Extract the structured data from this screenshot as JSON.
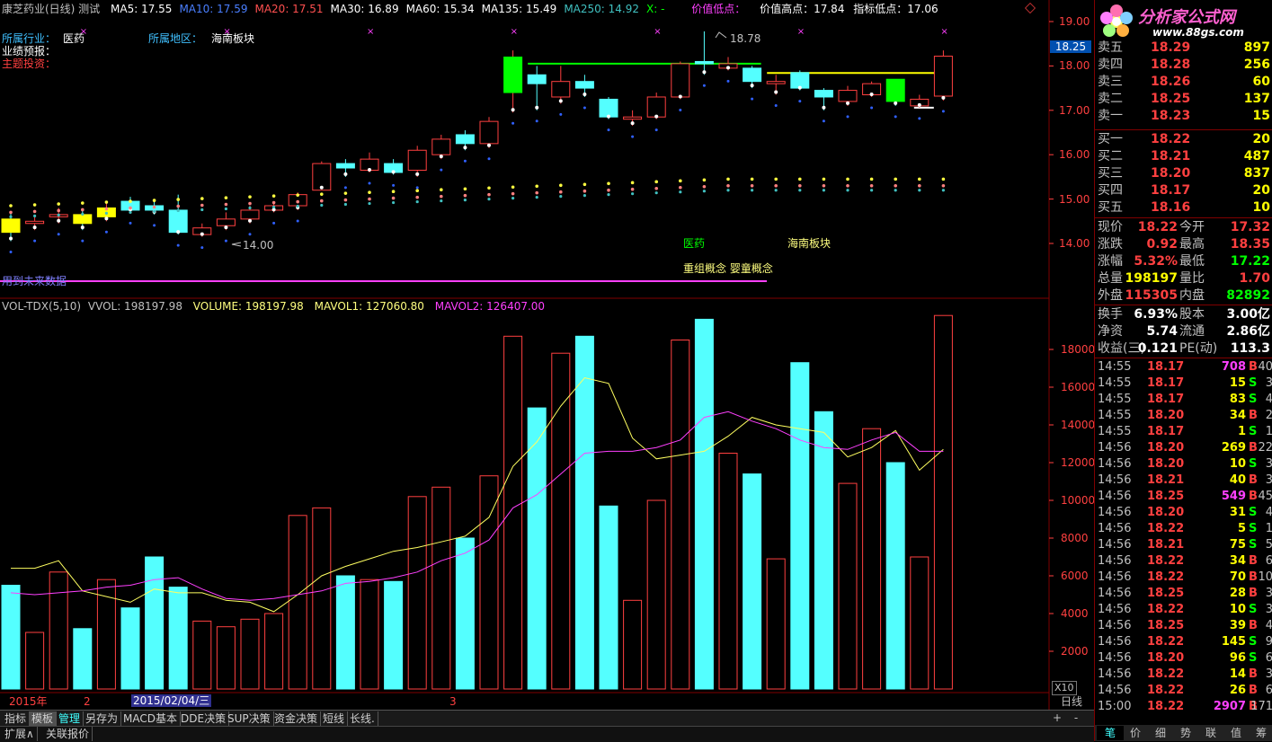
{
  "header": {
    "stock_name": "康芝药业(日线) 测试",
    "ma_items": [
      {
        "label": "MA5: 17.55",
        "color": "#ffffff"
      },
      {
        "label": "MA10: 17.59",
        "color": "#4a7fff"
      },
      {
        "label": "MA20: 17.51",
        "color": "#ff5050"
      },
      {
        "label": "MA30: 16.89",
        "color": "#ffffff"
      },
      {
        "label": "MA60: 15.34",
        "color": "#ffffff"
      },
      {
        "label": "MA135: 15.49",
        "color": "#ffffff"
      },
      {
        "label": "MA250: 14.92",
        "color": "#40c0c0"
      },
      {
        "label": "X: -",
        "color": "#00ff00"
      }
    ],
    "value_low_label": "价值低点：",
    "value_high_label": "价值高点：17.84",
    "indicator_low_label": "指标低点：17.06"
  },
  "info": {
    "industry_label": "所属行业：",
    "industry_value": "医药",
    "region_label": "所属地区：",
    "region_value": "海南板块",
    "forecast_label": "业绩预报：",
    "theme_label": "主题投资："
  },
  "annotations": {
    "high_mark": "18.78",
    "low_mark": "14.00",
    "industry_tag": "医药",
    "region_tag": "海南板块",
    "concept_tag": "重组概念 婴童概念",
    "future_data": "用到未来数据"
  },
  "price_axis": [
    "19.00",
    "18.00",
    "17.00",
    "16.00",
    "15.00",
    "14.00"
  ],
  "current_price_tag": "18.25",
  "volume_header": {
    "name": "VOL-TDX(5,10)",
    "vvol": "VVOL: 198197.98",
    "volume": "VOLUME: 198197.98",
    "mavol1": "MAVOL1: 127060.80",
    "mavol2": "MAVOL2: 126407.00"
  },
  "volume_axis": [
    "18000",
    "16000",
    "14000",
    "12000",
    "10000",
    "8000",
    "6000",
    "4000",
    "2000"
  ],
  "volume_unit": "X10",
  "date_axis": {
    "year": "2015年",
    "m2": "2",
    "m3": "3",
    "cursor_date": "2015/02/04/三",
    "period": "日线"
  },
  "chart_data": {
    "type": "candlestick",
    "candles": [
      {
        "o": 14.55,
        "c": 14.25,
        "h": 14.7,
        "l": 14.05,
        "v": 5500
      },
      {
        "o": 14.45,
        "c": 14.5,
        "h": 14.6,
        "l": 14.3,
        "v": 3000
      },
      {
        "o": 14.6,
        "c": 14.65,
        "h": 14.8,
        "l": 14.45,
        "v": 6200
      },
      {
        "o": 14.65,
        "c": 14.45,
        "h": 14.75,
        "l": 14.3,
        "v": 3200
      },
      {
        "o": 14.6,
        "c": 14.8,
        "h": 14.95,
        "l": 14.5,
        "v": 5800
      },
      {
        "o": 14.95,
        "c": 14.75,
        "h": 15.05,
        "l": 14.7,
        "v": 4300
      },
      {
        "o": 14.85,
        "c": 14.75,
        "h": 14.95,
        "l": 14.65,
        "v": 7000
      },
      {
        "o": 14.75,
        "c": 14.25,
        "h": 15.1,
        "l": 14.2,
        "v": 5400
      },
      {
        "o": 14.2,
        "c": 14.35,
        "h": 14.45,
        "l": 14.15,
        "v": 3600
      },
      {
        "o": 14.4,
        "c": 14.55,
        "h": 14.7,
        "l": 14.3,
        "v": 3300
      },
      {
        "o": 14.55,
        "c": 14.75,
        "h": 14.85,
        "l": 14.45,
        "v": 3700
      },
      {
        "o": 14.75,
        "c": 14.85,
        "h": 14.9,
        "l": 14.7,
        "v": 4000
      },
      {
        "o": 14.85,
        "c": 15.1,
        "h": 15.15,
        "l": 14.75,
        "v": 9200
      },
      {
        "o": 15.2,
        "c": 15.8,
        "h": 15.85,
        "l": 15.2,
        "v": 9600
      },
      {
        "o": 15.8,
        "c": 15.7,
        "h": 15.9,
        "l": 15.5,
        "v": 6000
      },
      {
        "o": 15.65,
        "c": 15.9,
        "h": 16.05,
        "l": 15.6,
        "v": 5800
      },
      {
        "o": 15.8,
        "c": 15.6,
        "h": 15.9,
        "l": 15.55,
        "v": 5700
      },
      {
        "o": 15.65,
        "c": 16.1,
        "h": 16.2,
        "l": 15.5,
        "v": 10200
      },
      {
        "o": 16.0,
        "c": 16.35,
        "h": 16.45,
        "l": 15.9,
        "v": 10700
      },
      {
        "o": 16.45,
        "c": 16.25,
        "h": 16.55,
        "l": 16.1,
        "v": 8000
      },
      {
        "o": 16.25,
        "c": 16.75,
        "h": 16.85,
        "l": 16.15,
        "v": 11300
      },
      {
        "o": 17.4,
        "c": 18.2,
        "h": 18.35,
        "l": 16.95,
        "v": 18700
      },
      {
        "o": 17.8,
        "c": 17.6,
        "h": 18.0,
        "l": 17.0,
        "v": 14900
      },
      {
        "o": 17.3,
        "c": 17.65,
        "h": 18.0,
        "l": 17.15,
        "v": 17800
      },
      {
        "o": 17.65,
        "c": 17.5,
        "h": 17.8,
        "l": 17.3,
        "v": 18700
      },
      {
        "o": 17.25,
        "c": 16.85,
        "h": 17.3,
        "l": 16.8,
        "v": 9700
      },
      {
        "o": 16.8,
        "c": 16.85,
        "h": 17.0,
        "l": 16.65,
        "v": 4700
      },
      {
        "o": 16.85,
        "c": 17.3,
        "h": 17.4,
        "l": 16.8,
        "v": 10000
      },
      {
        "o": 17.3,
        "c": 18.05,
        "h": 18.1,
        "l": 17.25,
        "v": 18500
      },
      {
        "o": 18.1,
        "c": 18.05,
        "h": 18.78,
        "l": 17.8,
        "v": 19600
      },
      {
        "o": 17.95,
        "c": 18.05,
        "h": 18.2,
        "l": 17.9,
        "v": 12500
      },
      {
        "o": 17.95,
        "c": 17.65,
        "h": 18.0,
        "l": 17.5,
        "v": 11400
      },
      {
        "o": 17.6,
        "c": 17.65,
        "h": 17.8,
        "l": 17.35,
        "v": 6900
      },
      {
        "o": 17.85,
        "c": 17.5,
        "h": 17.9,
        "l": 17.45,
        "v": 17300
      },
      {
        "o": 17.45,
        "c": 17.3,
        "h": 17.5,
        "l": 17.0,
        "v": 14700
      },
      {
        "o": 17.2,
        "c": 17.45,
        "h": 17.55,
        "l": 17.1,
        "v": 10900
      },
      {
        "o": 17.35,
        "c": 17.6,
        "h": 17.65,
        "l": 17.3,
        "v": 13800
      },
      {
        "o": 17.7,
        "c": 17.2,
        "h": 17.7,
        "l": 17.1,
        "v": 12000
      },
      {
        "o": 17.1,
        "c": 17.25,
        "h": 17.35,
        "l": 17.06,
        "v": 7000
      },
      {
        "o": 17.32,
        "c": 18.22,
        "h": 18.35,
        "l": 17.22,
        "v": 19800
      }
    ],
    "mavol1": [
      6400,
      6400,
      6800,
      5200,
      4900,
      4600,
      5300,
      5100,
      5100,
      4700,
      4600,
      4100,
      5000,
      6000,
      6500,
      6900,
      7300,
      7500,
      7800,
      8100,
      9100,
      11800,
      13100,
      15000,
      16500,
      16200,
      13300,
      12200,
      12400,
      12600,
      13400,
      14400,
      14000,
      13800,
      13600,
      12300,
      12800,
      13700,
      11600,
      12700
    ],
    "mavol2": [
      5100,
      5000,
      5100,
      5200,
      5400,
      5500,
      5800,
      5900,
      5300,
      4800,
      4700,
      4800,
      5000,
      5200,
      5600,
      5700,
      5900,
      6200,
      6800,
      7200,
      7900,
      9600,
      10300,
      11400,
      12500,
      12600,
      12600,
      12800,
      13200,
      14400,
      14700,
      14200,
      13800,
      13200,
      12800,
      12700,
      13200,
      13600,
      12600,
      12600
    ],
    "value_high": 17.84,
    "indicator_low": 17.06,
    "green_level": 18.05
  },
  "quote": {
    "sell": [
      {
        "label": "卖五",
        "price": "18.29",
        "vol": "897"
      },
      {
        "label": "卖四",
        "price": "18.28",
        "vol": "256"
      },
      {
        "label": "卖三",
        "price": "18.26",
        "vol": "60"
      },
      {
        "label": "卖二",
        "price": "18.25",
        "vol": "137"
      },
      {
        "label": "卖一",
        "price": "18.23",
        "vol": "15"
      }
    ],
    "buy": [
      {
        "label": "买一",
        "price": "18.22",
        "vol": "20"
      },
      {
        "label": "买二",
        "price": "18.21",
        "vol": "487"
      },
      {
        "label": "买三",
        "price": "18.20",
        "vol": "837"
      },
      {
        "label": "买四",
        "price": "18.17",
        "vol": "20"
      },
      {
        "label": "买五",
        "price": "18.16",
        "vol": "10"
      }
    ],
    "stats": [
      {
        "l1": "现价",
        "v1": "18.22",
        "c1": "#ff4040",
        "l2": "今开",
        "v2": "17.32",
        "c2": "#ff4040"
      },
      {
        "l1": "涨跌",
        "v1": "0.92",
        "c1": "#ff4040",
        "l2": "最高",
        "v2": "18.35",
        "c2": "#ff4040"
      },
      {
        "l1": "涨幅",
        "v1": "5.32%",
        "c1": "#ff4040",
        "l2": "最低",
        "v2": "17.22",
        "c2": "#00ff00"
      },
      {
        "l1": "总量",
        "v1": "198197",
        "c1": "#ffff00",
        "l2": "量比",
        "v2": "1.70",
        "c2": "#ff4040"
      },
      {
        "l1": "外盘",
        "v1": "115305",
        "c1": "#ff4040",
        "l2": "内盘",
        "v2": "82892",
        "c2": "#00ff00"
      }
    ],
    "stats2": [
      {
        "l1": "换手",
        "v1": "6.93%",
        "l2": "股本",
        "v2": "3.00亿"
      },
      {
        "l1": "净资",
        "v1": "5.74",
        "l2": "流通",
        "v2": "2.86亿"
      },
      {
        "l1": "收益(三)",
        "v1": "0.121",
        "l2": "PE(动)",
        "v2": "113.3"
      }
    ]
  },
  "ticks": [
    {
      "t": "14:55",
      "p": "18.17",
      "v": "708",
      "s": "B",
      "n": "40"
    },
    {
      "t": "14:55",
      "p": "18.17",
      "v": "15",
      "s": "S",
      "n": "3"
    },
    {
      "t": "14:55",
      "p": "18.17",
      "v": "83",
      "s": "S",
      "n": "4"
    },
    {
      "t": "14:55",
      "p": "18.20",
      "v": "34",
      "s": "B",
      "n": "2"
    },
    {
      "t": "14:55",
      "p": "18.17",
      "v": "1",
      "s": "S",
      "n": "1"
    },
    {
      "t": "14:56",
      "p": "18.20",
      "v": "269",
      "s": "B",
      "n": "22"
    },
    {
      "t": "14:56",
      "p": "18.20",
      "v": "10",
      "s": "S",
      "n": "3"
    },
    {
      "t": "14:56",
      "p": "18.21",
      "v": "40",
      "s": "B",
      "n": "3"
    },
    {
      "t": "14:56",
      "p": "18.25",
      "v": "549",
      "s": "B",
      "n": "45"
    },
    {
      "t": "14:56",
      "p": "18.20",
      "v": "31",
      "s": "S",
      "n": "4"
    },
    {
      "t": "14:56",
      "p": "18.22",
      "v": "5",
      "s": "S",
      "n": "1"
    },
    {
      "t": "14:56",
      "p": "18.21",
      "v": "75",
      "s": "S",
      "n": "5"
    },
    {
      "t": "14:56",
      "p": "18.22",
      "v": "34",
      "s": "B",
      "n": "6"
    },
    {
      "t": "14:56",
      "p": "18.22",
      "v": "70",
      "s": "B",
      "n": "10"
    },
    {
      "t": "14:56",
      "p": "18.25",
      "v": "28",
      "s": "B",
      "n": "3"
    },
    {
      "t": "14:56",
      "p": "18.22",
      "v": "10",
      "s": "S",
      "n": "3"
    },
    {
      "t": "14:56",
      "p": "18.25",
      "v": "39",
      "s": "B",
      "n": "4"
    },
    {
      "t": "14:56",
      "p": "18.22",
      "v": "145",
      "s": "S",
      "n": "9"
    },
    {
      "t": "14:56",
      "p": "18.20",
      "v": "96",
      "s": "S",
      "n": "6"
    },
    {
      "t": "14:56",
      "p": "18.22",
      "v": "14",
      "s": "B",
      "n": "3"
    },
    {
      "t": "14:56",
      "p": "18.22",
      "v": "26",
      "s": "B",
      "n": "6"
    },
    {
      "t": "15:00",
      "p": "18.22",
      "v": "2907",
      "s": "B",
      "n": "171"
    }
  ],
  "bottom_tabs": [
    "指标",
    "模板",
    "管理",
    "另存为",
    "MACD基本",
    "DDE决策",
    "SUP决策",
    "资金决策",
    "短线",
    "长线."
  ],
  "bottom_tabs2": [
    "扩展∧",
    "关联报价"
  ],
  "side_tabs": [
    "笔",
    "价",
    "细",
    "势",
    "联",
    "值",
    "筹"
  ],
  "logo": {
    "text": "分析家公式网",
    "url": "www.88gs.com"
  }
}
